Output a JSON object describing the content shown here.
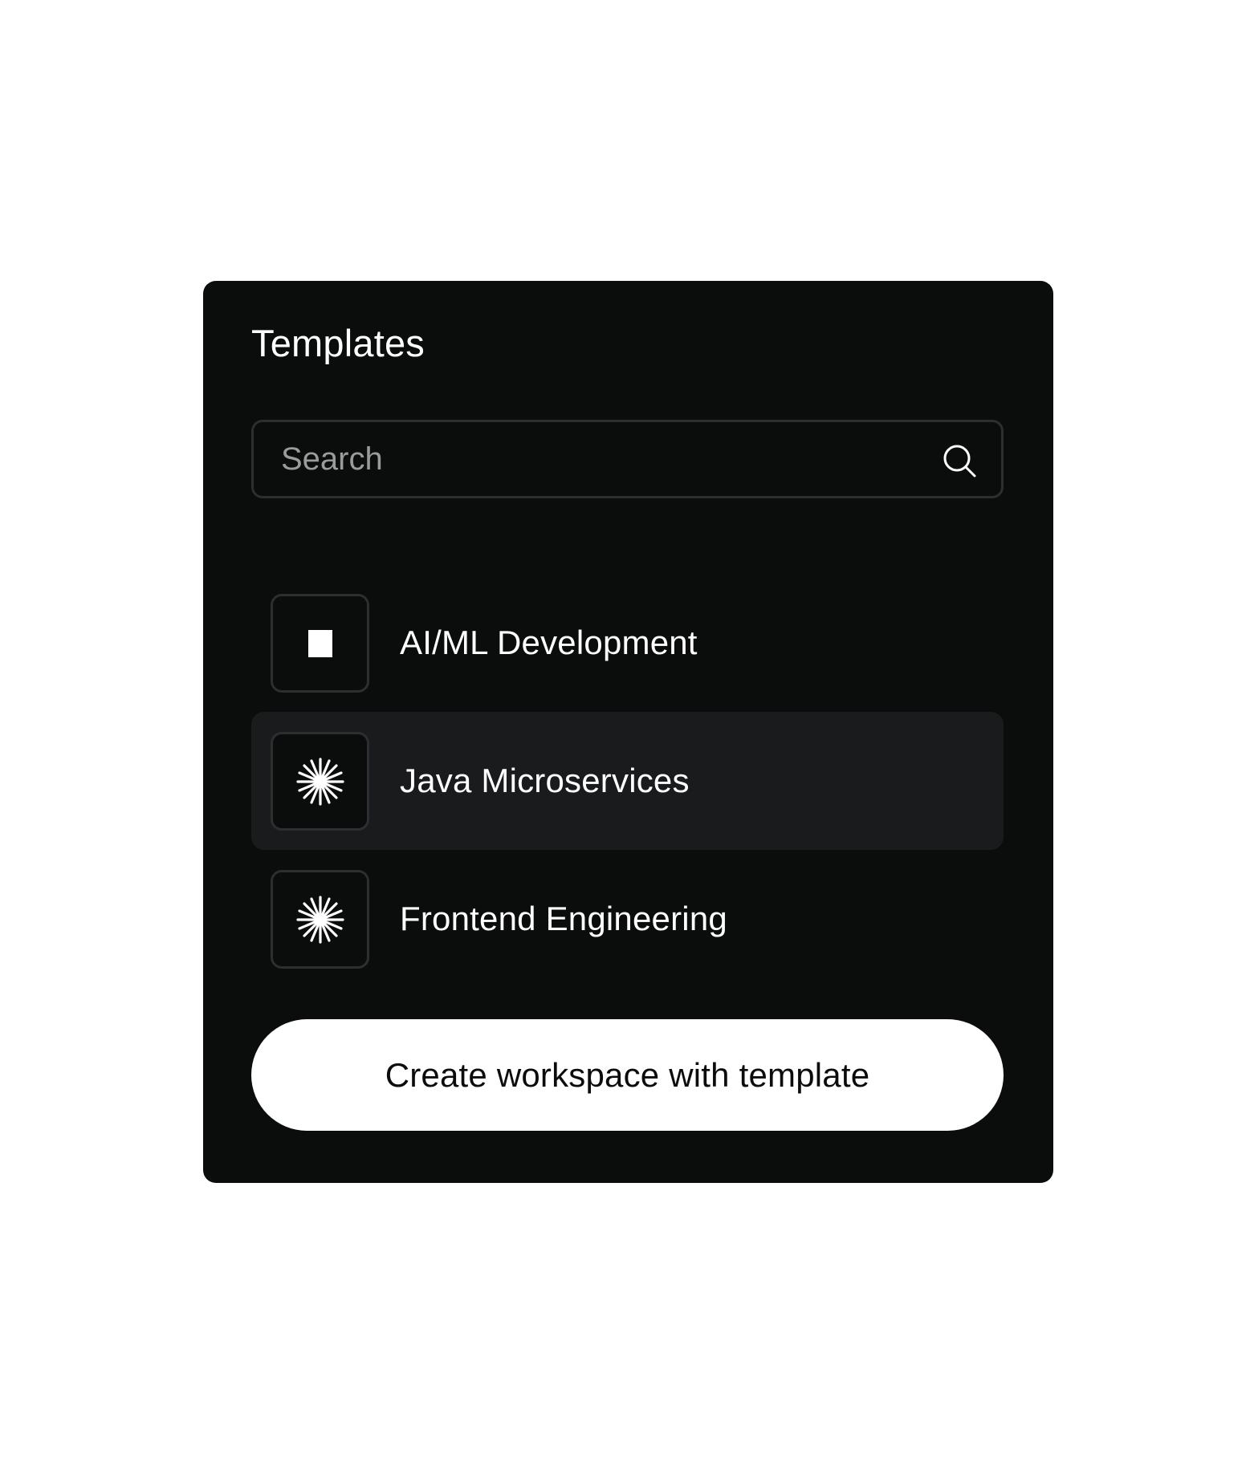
{
  "panel": {
    "title": "Templates"
  },
  "search": {
    "placeholder": "Search",
    "value": "",
    "icon": "search-icon"
  },
  "templates": [
    {
      "label": "AI/ML Development",
      "icon": "square-icon",
      "selected": false
    },
    {
      "label": "Java Microservices",
      "icon": "asterisk-icon",
      "selected": true
    },
    {
      "label": "Frontend Engineering",
      "icon": "asterisk-icon",
      "selected": false
    }
  ],
  "actions": {
    "create_label": "Create workspace with template"
  },
  "colors": {
    "panel_bg": "#0b0d0c",
    "selected_row_bg": "#1a1b1d",
    "border": "#2c2f31",
    "text": "#ffffff",
    "placeholder": "#9a9c9c",
    "button_bg": "#ffffff",
    "button_text": "#0b0d0c"
  }
}
